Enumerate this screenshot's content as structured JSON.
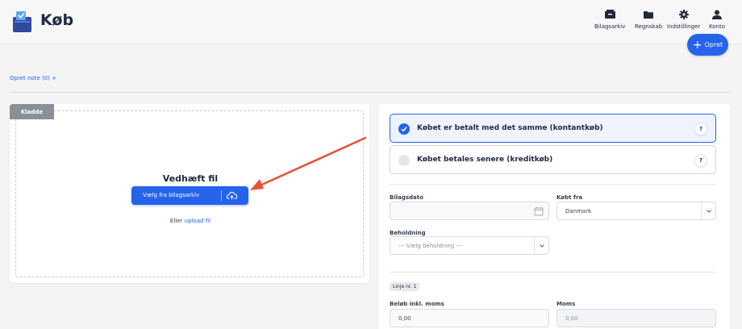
{
  "header": {
    "title": "Køb",
    "nav": [
      {
        "label": "Bilagsarkiv",
        "icon": "archive-icon"
      },
      {
        "label": "Regnskab",
        "icon": "folder-icon"
      },
      {
        "label": "Indstillinger",
        "icon": "gear-icon"
      },
      {
        "label": "Konto",
        "icon": "user-icon"
      }
    ],
    "create_label": "Opret"
  },
  "note_link": "Opret note (0) +",
  "upload": {
    "badge": "Kladde",
    "title": "Vedhæft fil",
    "pick_button": "Vælg fra bilagsarkiv",
    "or_text": "Eller",
    "upload_link": "upload fil"
  },
  "payment": {
    "options": [
      {
        "label": "Købet er betalt med det samme (kontantkøb)",
        "selected": true,
        "help": "?"
      },
      {
        "label": "Købet betales senere (kreditkøb)",
        "selected": false,
        "help": "?"
      }
    ]
  },
  "form": {
    "date_label": "Bilagsdato",
    "date_value": "",
    "bought_from_label": "Købt fra",
    "bought_from_value": "Danmark",
    "holding_label": "Beholdning",
    "holding_placeholder": "--- Vælg beholdning ---",
    "line_badge": "Linje nr. 1",
    "amount_label": "Beløb inkl. moms",
    "amount_value": "0,00",
    "vat_label": "Moms",
    "vat_value": "0,00"
  },
  "colors": {
    "accent": "#2563eb",
    "arrow": "#e5533a",
    "badge": "#8a9099"
  }
}
